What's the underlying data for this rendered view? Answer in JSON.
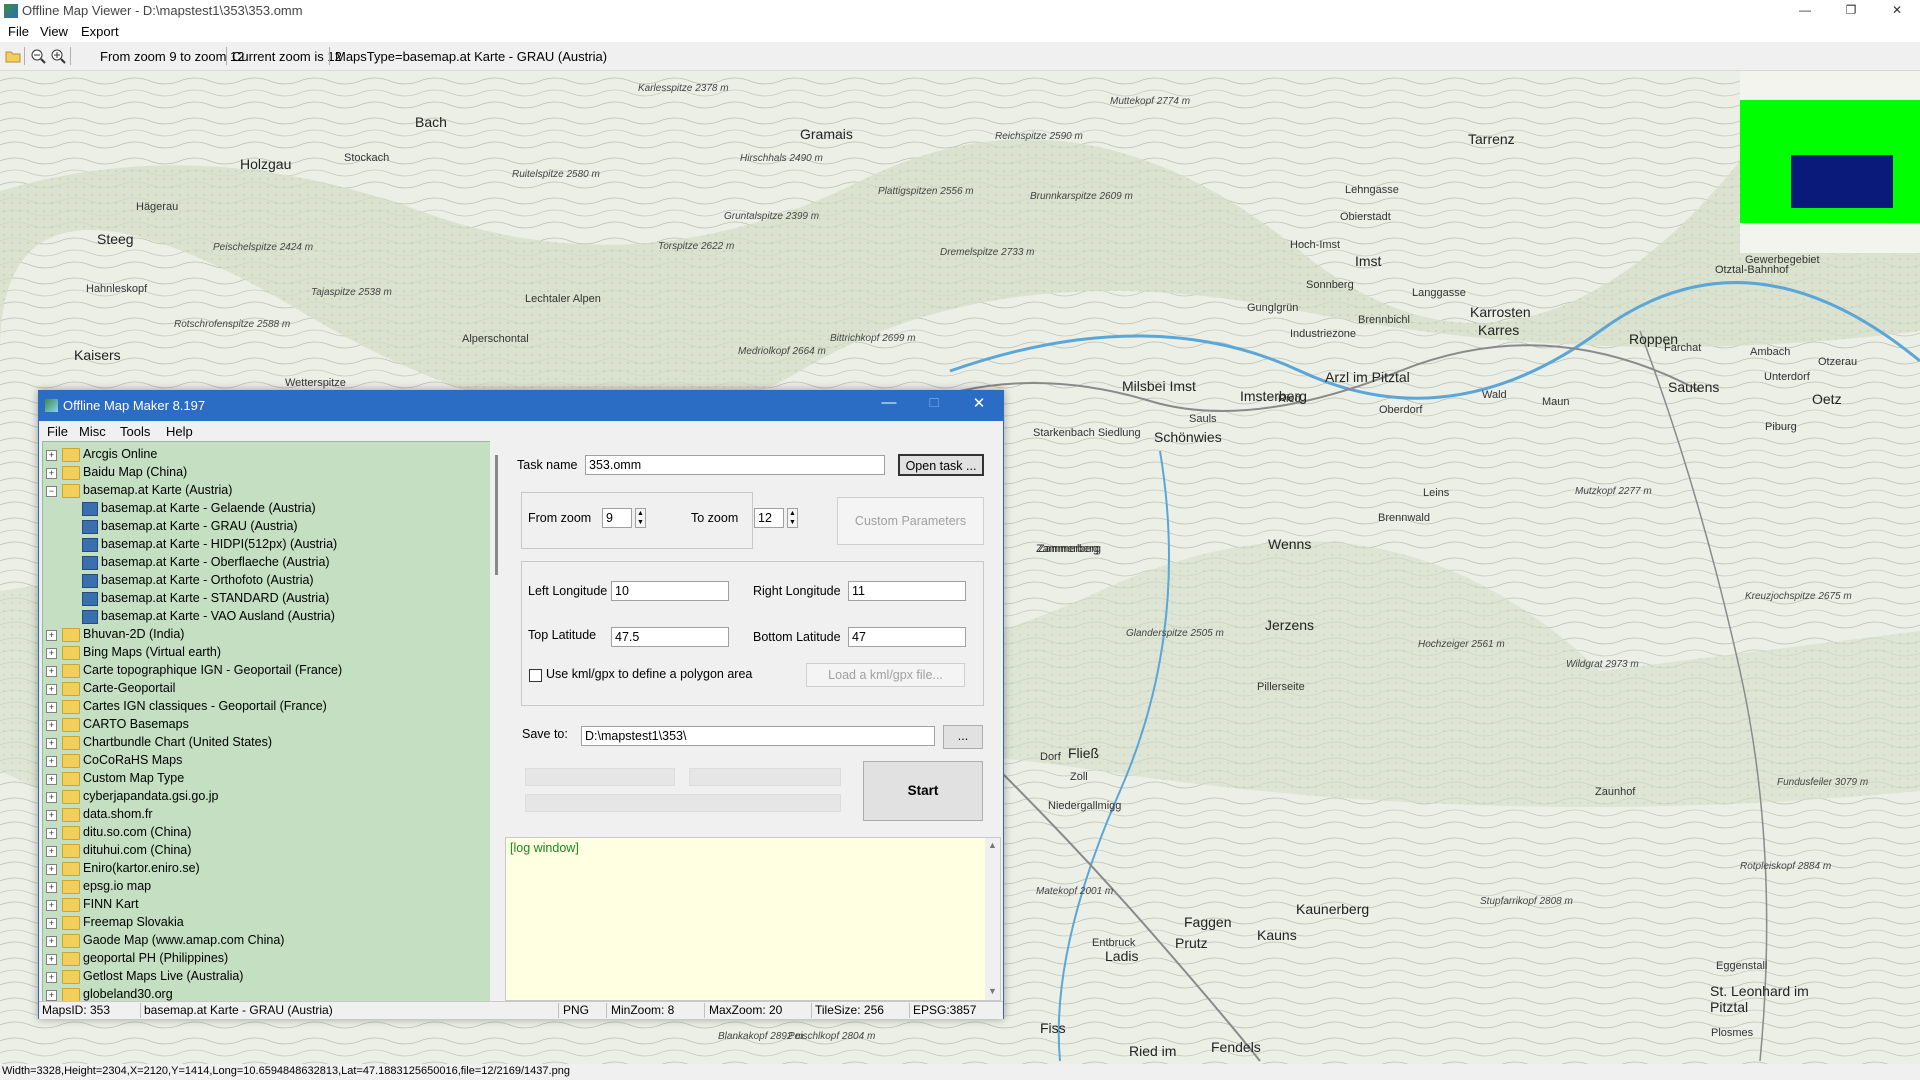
{
  "viewer": {
    "title": "Offline Map Viewer - D:\\mapstest1\\353\\353.omm",
    "menu": [
      "File",
      "View",
      "Export"
    ],
    "toolbar": {
      "from_zoom": "From zoom 9 to zoom 12",
      "current_zoom": "Current zoom is 12",
      "maps_type": "MapsType=basemap.at Karte - GRAU (Austria)"
    },
    "status": "Width=3328,Height=2304,X=2120,Y=1414,Long=10.6594848632813,Lat=47.1883125650016,file=12/2169/1437.png"
  },
  "map": {
    "places": [
      "Bach",
      "Holzgau",
      "Steeg",
      "Kaisers",
      "Gramais",
      "Tarrenz",
      "Imst",
      "Karrosten",
      "Karres",
      "Roppen",
      "Sautens",
      "Oetz",
      "Arzl im Pitztal",
      "Milsbei Imst",
      "Imsterberg",
      "Schönwies",
      "Wenns",
      "Jerzens",
      "Fließ",
      "Kaunerberg",
      "Faggen",
      "Prutz",
      "Kauns",
      "Ladis",
      "Fiss",
      "Ried im",
      "Fendels",
      "St. Leonhard im Pitztal",
      "Lechtaler Alpen",
      "Zammerberg",
      "Zaunhof",
      "Pillerseite"
    ],
    "small_places": [
      "Stockach",
      "Hägerau",
      "Hahnleskopf",
      "Alperschontal",
      "Wetterspitze",
      "Lehngasse",
      "Obierstadt",
      "Hoch-Imst",
      "Sonnberg",
      "Langgasse",
      "Gunglgrün",
      "Brennbichl",
      "Industriezone",
      "Ried",
      "Sauls",
      "Oberdorf",
      "Wald",
      "Maun",
      "Leins",
      "Brennwald",
      "Zammerberg",
      "Niedergallmigg",
      "Zoll",
      "Dorf",
      "Gewerbegebiet",
      "Otztal-Bahnhof",
      "Farchat",
      "Ambach",
      "Otzerau",
      "Unterdorf",
      "Piburg",
      "Starkenbach Siedlung",
      "Entbruck",
      "Eggenstall",
      "Plosmes"
    ],
    "peaks": [
      "Karlesspitze 2378 m",
      "Muttekopf 2774 m",
      "Ruitelspitze 2580 m",
      "Hirschhals 2490 m",
      "Plattigspitzen 2556 m",
      "Gruntalspitze 2399 m",
      "Torspitze 2622 m",
      "Dremelspitze 2733 m",
      "Reichspitze 2590 m",
      "Brunnkarspitze 2609 m",
      "Peischelspitze 2424 m",
      "Tajaspitze 2538 m",
      "Rotschrofenspitze 2588 m",
      "Bittrichkopf 2699 m",
      "Medriolkopf 2664 m",
      "Mutzkopf 2277 m",
      "Wildgrat 2973 m",
      "Hochzeiger 2561 m",
      "Glanderspitze 2505 m",
      "Kreuzjochspitze 2675 m",
      "Fundusfeiler 3079 m",
      "Rotpleiskopf 2884 m",
      "Stupfarrikopf 2808 m",
      "Matekopf 2001 m",
      "Blankakopf 2892 m",
      "Peischlkopf 2804 m"
    ],
    "overview": {
      "frame_color": "#00ff00",
      "view_color": "#0a1a7a"
    }
  },
  "dialog": {
    "title": "Offline Map Maker 8.197",
    "menu": [
      "File",
      "Misc",
      "Tools",
      "Help"
    ],
    "tree": [
      {
        "label": "Arcgis Online",
        "level": 0,
        "expanded": false
      },
      {
        "label": "Baidu Map (China)",
        "level": 0,
        "expanded": false
      },
      {
        "label": "basemap.at Karte (Austria)",
        "level": 0,
        "expanded": true
      },
      {
        "label": "basemap.at Karte - Gelaende (Austria)",
        "level": 1
      },
      {
        "label": "basemap.at Karte - GRAU (Austria)",
        "level": 1
      },
      {
        "label": "basemap.at Karte - HIDPI(512px) (Austria)",
        "level": 1
      },
      {
        "label": "basemap.at Karte - Oberflaeche (Austria)",
        "level": 1
      },
      {
        "label": "basemap.at Karte - Orthofoto (Austria)",
        "level": 1
      },
      {
        "label": "basemap.at Karte - STANDARD (Austria)",
        "level": 1
      },
      {
        "label": "basemap.at Karte - VAO Ausland (Austria)",
        "level": 1
      },
      {
        "label": "Bhuvan-2D (India)",
        "level": 0,
        "expanded": false
      },
      {
        "label": "Bing Maps (Virtual earth)",
        "level": 0,
        "expanded": false
      },
      {
        "label": "Carte topographique IGN - Geoportail (France)",
        "level": 0,
        "expanded": false
      },
      {
        "label": "Carte-Geoportail",
        "level": 0,
        "expanded": false
      },
      {
        "label": "Cartes IGN classiques - Geoportail (France)",
        "level": 0,
        "expanded": false
      },
      {
        "label": "CARTO Basemaps",
        "level": 0,
        "expanded": false
      },
      {
        "label": "Chartbundle Chart (United States)",
        "level": 0,
        "expanded": false
      },
      {
        "label": "CoCoRaHS Maps",
        "level": 0,
        "expanded": false
      },
      {
        "label": "Custom Map Type",
        "level": 0,
        "expanded": false
      },
      {
        "label": "cyberjapandata.gsi.go.jp",
        "level": 0,
        "expanded": false
      },
      {
        "label": "data.shom.fr",
        "level": 0,
        "expanded": false
      },
      {
        "label": "ditu.so.com (China)",
        "level": 0,
        "expanded": false
      },
      {
        "label": "dituhui.com (China)",
        "level": 0,
        "expanded": false
      },
      {
        "label": "Eniro(kartor.eniro.se)",
        "level": 0,
        "expanded": false
      },
      {
        "label": "epsg.io map",
        "level": 0,
        "expanded": false
      },
      {
        "label": "FINN Kart",
        "level": 0,
        "expanded": false
      },
      {
        "label": "Freemap Slovakia",
        "level": 0,
        "expanded": false
      },
      {
        "label": "Gaode Map (www.amap.com China)",
        "level": 0,
        "expanded": false
      },
      {
        "label": "geoportal PH (Philippines)",
        "level": 0,
        "expanded": false
      },
      {
        "label": "Getlost Maps Live (Australia)",
        "level": 0,
        "expanded": false
      },
      {
        "label": "globeland30.org",
        "level": 0,
        "expanded": false
      }
    ],
    "form": {
      "task_name_label": "Task name",
      "task_name_value": "353.omm",
      "open_task_label": "Open task ...",
      "from_zoom_label": "From zoom",
      "from_zoom_value": "9",
      "to_zoom_label": "To zoom",
      "to_zoom_value": "12",
      "custom_params_label": "Custom Parameters",
      "left_lon_label": "Left Longitude",
      "left_lon_value": "10",
      "right_lon_label": "Right Longitude",
      "right_lon_value": "11",
      "top_lat_label": "Top Latitude",
      "top_lat_value": "47.5",
      "bottom_lat_label": "Bottom Latitude",
      "bottom_lat_value": "47",
      "kml_checkbox_label": "Use kml/gpx to define a polygon area",
      "kml_checked": false,
      "load_kml_label": "Load a kml/gpx file...",
      "save_to_label": "Save to:",
      "save_to_value": "D:\\mapstest1\\353\\",
      "browse_label": "...",
      "start_label": "Start",
      "log_text": "[log window]"
    },
    "status": {
      "maps_id": "MapsID: 353",
      "maps_name": "basemap.at Karte - GRAU (Austria)",
      "format": "PNG",
      "min_zoom": "MinZoom: 8",
      "max_zoom": "MaxZoom: 20",
      "tile_size": "TileSize: 256",
      "epsg": "EPSG:3857"
    }
  }
}
